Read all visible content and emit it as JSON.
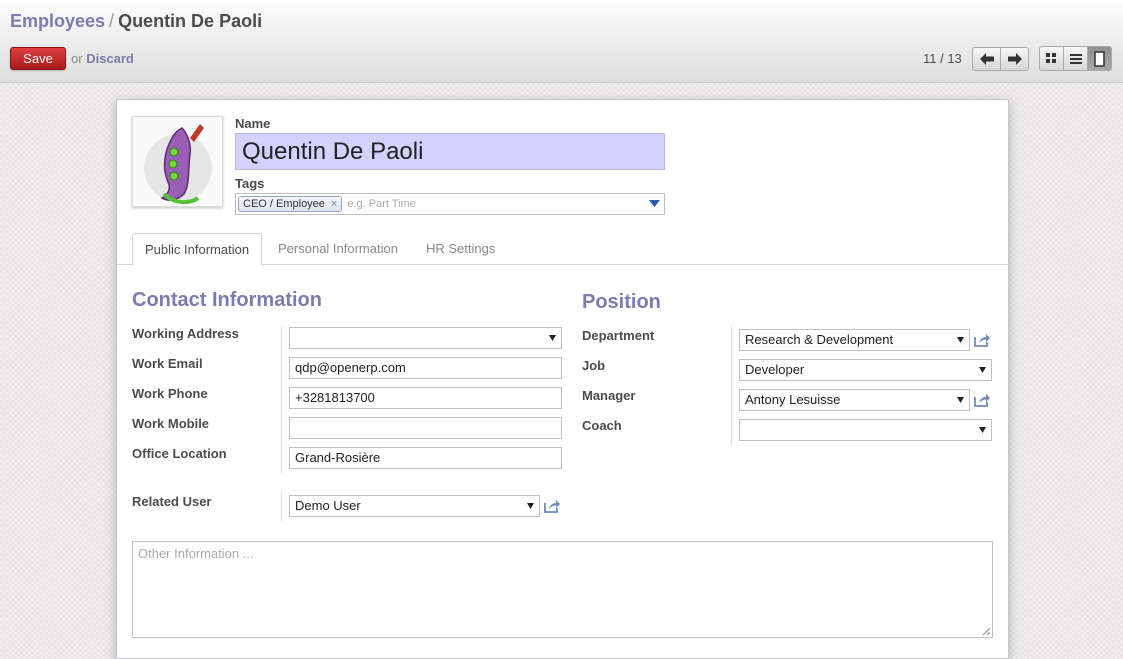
{
  "breadcrumb": {
    "parent": "Employees",
    "separator": "/",
    "current": "Quentin De Paoli"
  },
  "toolbar": {
    "save_label": "Save",
    "or_text": "or",
    "discard_label": "Discard"
  },
  "pager": {
    "text": "11 / 13"
  },
  "views": [
    "kanban-icon",
    "list-icon",
    "form-icon"
  ],
  "employee": {
    "name_label": "Name",
    "name": "Quentin De Paoli",
    "tags_label": "Tags",
    "tags": [
      "CEO / Employee"
    ],
    "tags_placeholder": "e.g. Part Time"
  },
  "tabs": [
    {
      "label": "Public Information",
      "active": true
    },
    {
      "label": "Personal Information",
      "active": false
    },
    {
      "label": "HR Settings",
      "active": false
    }
  ],
  "contact": {
    "title": "Contact Information",
    "working_address_label": "Working Address",
    "working_address_value": "",
    "work_email_label": "Work Email",
    "work_email_value": "qdp@openerp.com",
    "work_phone_label": "Work Phone",
    "work_phone_value": "+3281813700",
    "work_mobile_label": "Work Mobile",
    "work_mobile_value": "",
    "office_location_label": "Office Location",
    "office_location_value": "Grand-Rosière",
    "related_user_label": "Related User",
    "related_user_value": "Demo User"
  },
  "position": {
    "title": "Position",
    "department_label": "Department",
    "department_value": "Research & Development",
    "job_label": "Job",
    "job_value": "Developer",
    "manager_label": "Manager",
    "manager_value": "Antony Lesuisse",
    "coach_label": "Coach",
    "coach_value": ""
  },
  "notes": {
    "placeholder": "Other Information ..."
  },
  "colors": {
    "accent": "#7c7bad",
    "save": "#c9302c",
    "name_bg": "#d2d2ff"
  }
}
